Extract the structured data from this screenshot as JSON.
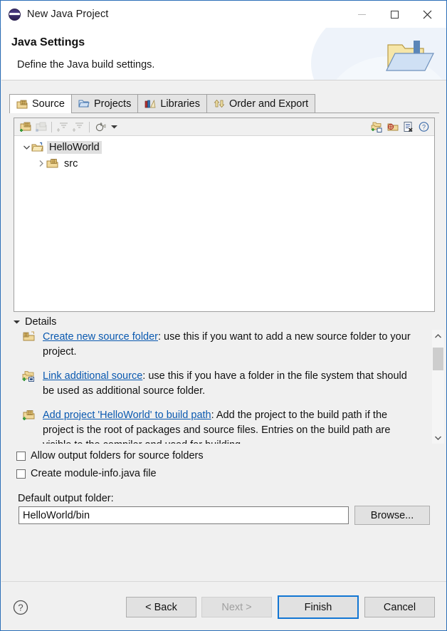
{
  "window": {
    "title": "New Java Project",
    "icon": "eclipse-sphere-icon",
    "minimize_label": "Minimize",
    "maximize_label": "Maximize",
    "close_label": "Close"
  },
  "banner": {
    "title": "Java Settings",
    "subtitle": "Define the Java build settings.",
    "icon": "folder-with-down-arrow-icon"
  },
  "tabs": [
    {
      "label": "Source",
      "icon": "source-folder-icon",
      "active": true
    },
    {
      "label": "Projects",
      "icon": "project-folder-icon",
      "active": false
    },
    {
      "label": "Libraries",
      "icon": "library-books-icon",
      "active": false
    },
    {
      "label": "Order and Export",
      "icon": "order-export-icon",
      "active": false
    }
  ],
  "tree_toolbar": {
    "left_buttons": [
      {
        "name": "add-folder-button",
        "enabled": true
      },
      {
        "name": "remove-folder-button",
        "enabled": false
      },
      {
        "name": "collapse-filter-button",
        "enabled": false
      },
      {
        "name": "expand-filter-button",
        "enabled": false
      },
      {
        "name": "configure-inclusion-button",
        "enabled": true
      }
    ],
    "dropdown_caret": "chevron-down-icon",
    "right_buttons": [
      {
        "name": "link-source-button"
      },
      {
        "name": "add-project-button"
      },
      {
        "name": "remove-entry-button"
      },
      {
        "name": "help-button"
      }
    ]
  },
  "tree": [
    {
      "label": "HelloWorld",
      "icon": "java-project-folder-icon",
      "expanded": true,
      "selected": true,
      "indent": 0
    },
    {
      "label": "src",
      "icon": "source-folder-icon",
      "expanded": false,
      "selected": false,
      "indent": 1
    }
  ],
  "details": {
    "header": "Details",
    "expanded": true,
    "items": [
      {
        "icon": "create-source-folder-icon",
        "link": "Create new source folder",
        "text": ": use this if you want to add a new source folder to your project."
      },
      {
        "icon": "link-additional-source-icon",
        "link": "Link additional source",
        "text": ": use this if you have a folder in the file system that should be used as additional source folder."
      },
      {
        "icon": "add-project-to-build-path-icon",
        "link": "Add project 'HelloWorld' to build path",
        "text": ": Add the project to the build path if the project is the root of packages and source files. Entries on the build path are visible to the compiler and used for building"
      }
    ],
    "scrollbar": {
      "up_arrow": "chevron-up-icon",
      "down_arrow": "chevron-down-icon"
    }
  },
  "options": [
    {
      "label": "Allow output folders for source folders",
      "checked": false
    },
    {
      "label": "Create module-info.java file",
      "checked": false
    }
  ],
  "output_folder": {
    "label": "Default output folder:",
    "value": "HelloWorld/bin",
    "browse_label": "Browse..."
  },
  "footer": {
    "help_icon": "help-circle-icon",
    "buttons": [
      {
        "label": "< Back",
        "enabled": true,
        "default": false
      },
      {
        "label": "Next >",
        "enabled": false,
        "default": false
      },
      {
        "label": "Finish",
        "enabled": true,
        "default": true
      },
      {
        "label": "Cancel",
        "enabled": true,
        "default": false
      }
    ]
  },
  "colors": {
    "window_border": "#2c6fb8",
    "dialog_background": "#f0f0f0",
    "link": "#0a59b0",
    "default_button_border": "#1276d3",
    "selection": "#e0e0e0"
  }
}
